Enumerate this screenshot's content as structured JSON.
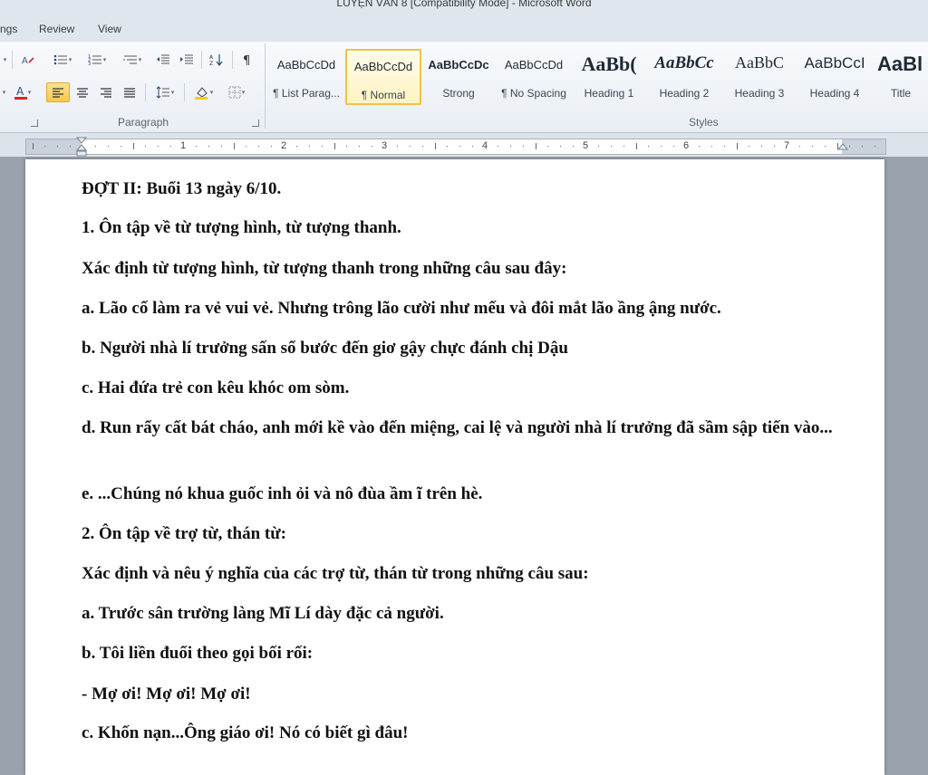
{
  "window": {
    "title": "LUYỆN VĂN 8 [Compatibility Mode]  -  Microsoft Word"
  },
  "menu": {
    "tabs": [
      "ngs",
      "Review",
      "View"
    ]
  },
  "ribbon": {
    "paragraph_label": "Paragraph",
    "styles_label": "Styles",
    "styles": [
      {
        "sample": "AaBbCcDd",
        "name": "¶ List Parag..."
      },
      {
        "sample": "AaBbCcDd",
        "name": "¶ Normal"
      },
      {
        "sample": "AaBbCcDc",
        "name": "Strong"
      },
      {
        "sample": "AaBbCcDd",
        "name": "¶ No Spacing"
      },
      {
        "sample": "AaBb(",
        "name": "Heading 1"
      },
      {
        "sample": "AaBbCc",
        "name": "Heading 2"
      },
      {
        "sample": "AaBbC",
        "name": "Heading 3"
      },
      {
        "sample": "AaBbCcI",
        "name": "Heading 4"
      },
      {
        "sample": "AaBl",
        "name": "Title"
      }
    ],
    "selected_style": "Normal"
  },
  "ruler": {
    "numbers": [
      "1",
      "2",
      "3",
      "4",
      "5",
      "6",
      "7"
    ]
  },
  "document": {
    "lines": [
      "ĐỢT II: Buổi 13 ngày 6/10.",
      "1. Ôn tập về từ tượng hình, từ tượng thanh.",
      "Xác định từ tượng hình, từ tượng thanh trong những câu sau đây:",
      "a. Lão cố làm ra vẻ vui vẻ. Nhưng trông lão cười như mếu và đôi mắt lão ầng ậng nước.",
      "b. Người nhà lí trưởng sấn sổ bước đến giơ gậy chực đánh chị Dậu",
      "c. Hai đứa trẻ con kêu khóc om sòm.",
      "d. Run rẩy cất bát cháo, anh mới kề vào đến miệng, cai lệ và người nhà lí trưởng đã sầm sập tiến vào...",
      "e. ...Chúng nó khua guốc inh ỏi và nô đùa ầm ĩ trên hè.",
      "2. Ôn tập về trợ từ, thán từ:",
      "Xác định và nêu ý nghĩa của các trợ từ, thán từ trong những câu sau:",
      "a. Trước sân trường làng Mĩ Lí dày đặc cả người.",
      "b. Tôi liền đuổi theo gọi bối rối:",
      "- Mợ ơi! Mợ ơi! Mợ ơi!",
      "c. Khốn nạn...Ông giáo ơi! Nó có biết gì đâu!"
    ]
  },
  "colors": {
    "highlight": "#f8c851",
    "font_color_bar": "#e02020",
    "shading_bar": "#f0d000"
  }
}
